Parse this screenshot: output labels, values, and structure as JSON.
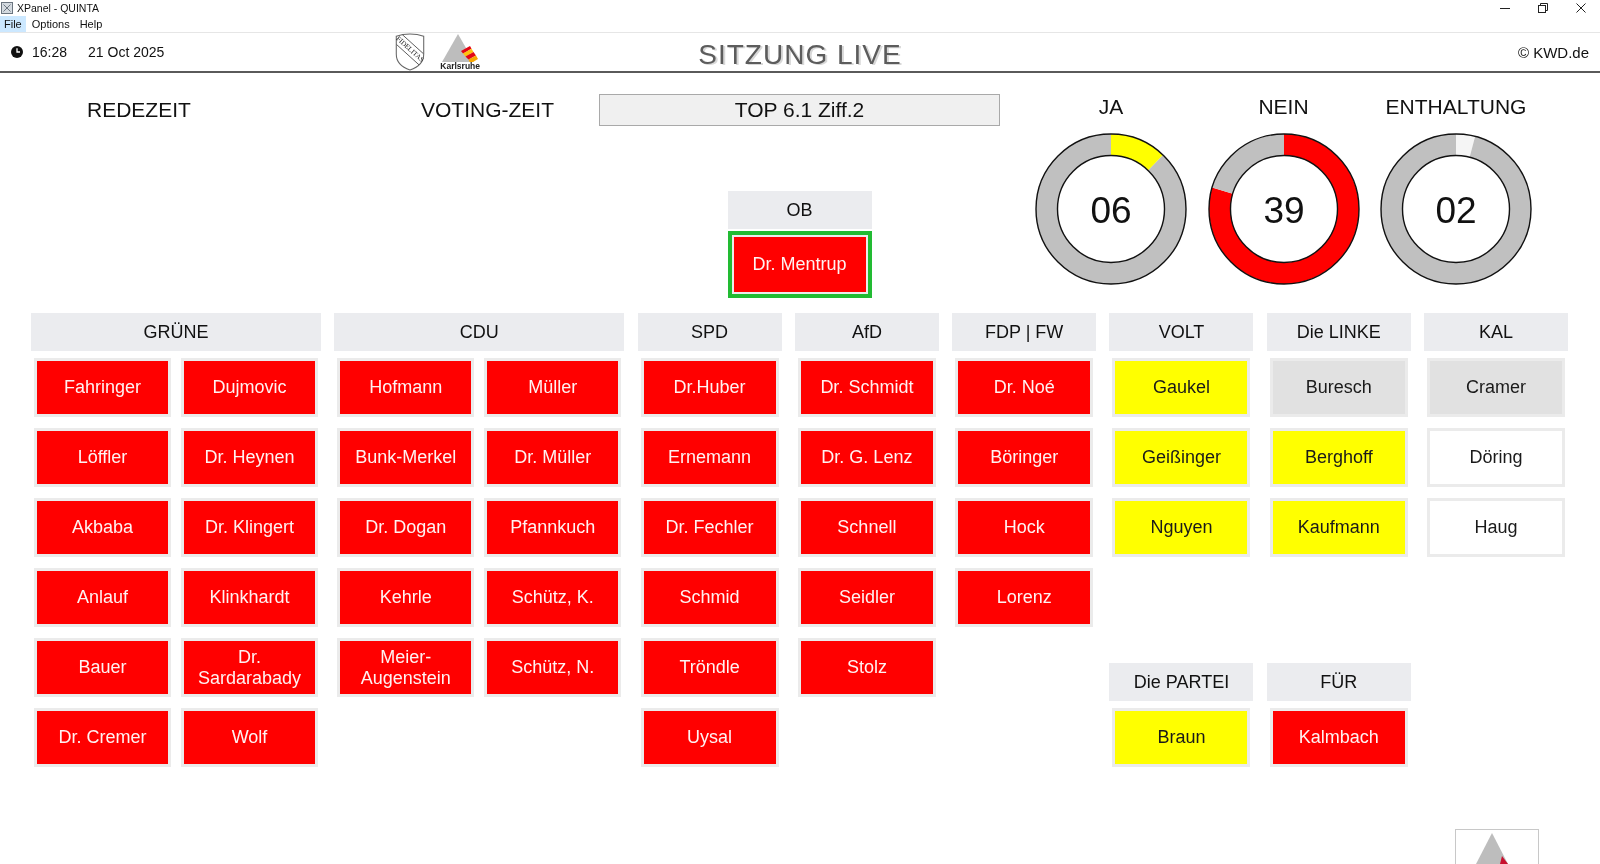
{
  "window": {
    "title": "XPanel - QUINTA"
  },
  "menu": [
    {
      "label": "File",
      "selected": true
    },
    {
      "label": "Options",
      "selected": false
    },
    {
      "label": "Help",
      "selected": false
    }
  ],
  "info_bar": {
    "time": "16:28",
    "date": "21 Oct 2025",
    "shield_motto": "FIDELITAS",
    "logo_text": "Karlsruhe",
    "title": "SITZUNG LIVE",
    "copyright": "© KWD.de"
  },
  "timers": {
    "speaking_time_label": "REDEZEIT",
    "voting_time_label": "VOTING-ZEIT",
    "agenda_item": "TOP 6.1 Ziff.2"
  },
  "chair": {
    "name": "OB",
    "members": [
      {
        "name": "Dr. Mentrup",
        "color": "#ff0000",
        "highlighted": true
      }
    ]
  },
  "tallies": [
    {
      "count": "06",
      "color": "#ffff00",
      "chart_data": {
        "type": "donut",
        "title": "JA",
        "values": [
          12.2,
          87.8
        ]
      }
    },
    {
      "count": "39",
      "color": "#ff0000",
      "chart_data": {
        "type": "donut",
        "title": "NEIN",
        "values": [
          79.6,
          20.4
        ]
      }
    },
    {
      "count": "02",
      "color": "#f5f5f5",
      "chart_data": {
        "type": "donut",
        "title": "ENTHALTUNG",
        "values": [
          4.1,
          95.9
        ]
      }
    }
  ],
  "seat_columns": [
    {
      "groups": [
        {
          "name": "GRÜNE",
          "members": [
            {
              "name": "Fahringer",
              "color": "#ff0000",
              "highlighted": false
            },
            {
              "name": "Dujmovic",
              "color": "#ff0000",
              "highlighted": false
            },
            {
              "name": "Löffler",
              "color": "#ff0000",
              "highlighted": false
            },
            {
              "name": "Dr. Heynen",
              "color": "#ff0000",
              "highlighted": false
            },
            {
              "name": "Akbaba",
              "color": "#ff0000",
              "highlighted": false
            },
            {
              "name": "Dr. Klingert",
              "color": "#ff0000",
              "highlighted": false
            },
            {
              "name": "Anlauf",
              "color": "#ff0000",
              "highlighted": false
            },
            {
              "name": "Klinkhardt",
              "color": "#ff0000",
              "highlighted": false
            },
            {
              "name": "Bauer",
              "color": "#ff0000",
              "highlighted": false
            },
            {
              "name": "Dr. Sardarabady",
              "color": "#ff0000",
              "highlighted": false
            },
            {
              "name": "Dr. Cremer",
              "color": "#ff0000",
              "highlighted": false
            },
            {
              "name": "Wolf",
              "color": "#ff0000",
              "highlighted": false
            }
          ]
        }
      ]
    },
    {
      "groups": [
        {
          "name": "CDU",
          "members": [
            {
              "name": "Hofmann",
              "color": "#ff0000",
              "highlighted": false
            },
            {
              "name": "Müller",
              "color": "#ff0000",
              "highlighted": false
            },
            {
              "name": "Bunk-Merkel",
              "color": "#ff0000",
              "highlighted": false
            },
            {
              "name": "Dr. Müller",
              "color": "#ff0000",
              "highlighted": false
            },
            {
              "name": "Dr. Dogan",
              "color": "#ff0000",
              "highlighted": false
            },
            {
              "name": "Pfannkuch",
              "color": "#ff0000",
              "highlighted": false
            },
            {
              "name": "Kehrle",
              "color": "#ff0000",
              "highlighted": false
            },
            {
              "name": "Schütz, K.",
              "color": "#ff0000",
              "highlighted": false
            },
            {
              "name": "Meier-Augenstein",
              "color": "#ff0000",
              "highlighted": false
            },
            {
              "name": "Schütz, N.",
              "color": "#ff0000",
              "highlighted": false
            }
          ]
        }
      ]
    },
    {
      "groups": [
        {
          "name": "SPD",
          "members": [
            {
              "name": "Dr.Huber",
              "color": "#ff0000",
              "highlighted": false
            },
            {
              "name": "Ernemann",
              "color": "#ff0000",
              "highlighted": false
            },
            {
              "name": "Dr. Fechler",
              "color": "#ff0000",
              "highlighted": false
            },
            {
              "name": "Schmid",
              "color": "#ff0000",
              "highlighted": false
            },
            {
              "name": "Tröndle",
              "color": "#ff0000",
              "highlighted": false
            },
            {
              "name": "Uysal",
              "color": "#ff0000",
              "highlighted": false
            }
          ]
        }
      ]
    },
    {
      "groups": [
        {
          "name": "AfD",
          "members": [
            {
              "name": "Dr. Schmidt",
              "color": "#ff0000",
              "highlighted": false
            },
            {
              "name": "Dr. G. Lenz",
              "color": "#ff0000",
              "highlighted": false
            },
            {
              "name": "Schnell",
              "color": "#ff0000",
              "highlighted": false
            },
            {
              "name": "Seidler",
              "color": "#ff0000",
              "highlighted": false
            },
            {
              "name": "Stolz",
              "color": "#ff0000",
              "highlighted": false
            }
          ]
        }
      ]
    },
    {
      "groups": [
        {
          "name": "FDP | FW",
          "members": [
            {
              "name": "Dr. Noé",
              "color": "#ff0000",
              "highlighted": false
            },
            {
              "name": "Böringer",
              "color": "#ff0000",
              "highlighted": false
            },
            {
              "name": "Hock",
              "color": "#ff0000",
              "highlighted": false
            },
            {
              "name": "Lorenz",
              "color": "#ff0000",
              "highlighted": false
            }
          ]
        }
      ]
    },
    {
      "groups": [
        {
          "name": "VOLT",
          "members": [
            {
              "name": "Gaukel",
              "color": "#ffff00",
              "highlighted": false
            },
            {
              "name": "Geißinger",
              "color": "#ffff00",
              "highlighted": false
            },
            {
              "name": "Nguyen",
              "color": "#ffff00",
              "highlighted": false
            }
          ]
        },
        {
          "name": "Die PARTEI",
          "members": [
            {
              "name": "Braun",
              "color": "#ffff00",
              "highlighted": false
            }
          ]
        }
      ]
    },
    {
      "groups": [
        {
          "name": "Die LINKE",
          "members": [
            {
              "name": "Buresch",
              "color": "#e1e1e1",
              "highlighted": false
            },
            {
              "name": "Berghoff",
              "color": "#ffff00",
              "highlighted": false
            },
            {
              "name": "Kaufmann",
              "color": "#ffff00",
              "highlighted": false
            }
          ]
        },
        {
          "name": "FÜR",
          "members": [
            {
              "name": "Kalmbach",
              "color": "#ff0000",
              "highlighted": false
            }
          ]
        }
      ]
    },
    {
      "groups": [
        {
          "name": "KAL",
          "members": [
            {
              "name": "Cramer",
              "color": "#e1e1e1",
              "highlighted": false
            },
            {
              "name": "Döring",
              "color": "#ffffff",
              "highlighted": false
            },
            {
              "name": "Haug",
              "color": "#ffffff",
              "highlighted": false
            }
          ]
        }
      ]
    }
  ]
}
